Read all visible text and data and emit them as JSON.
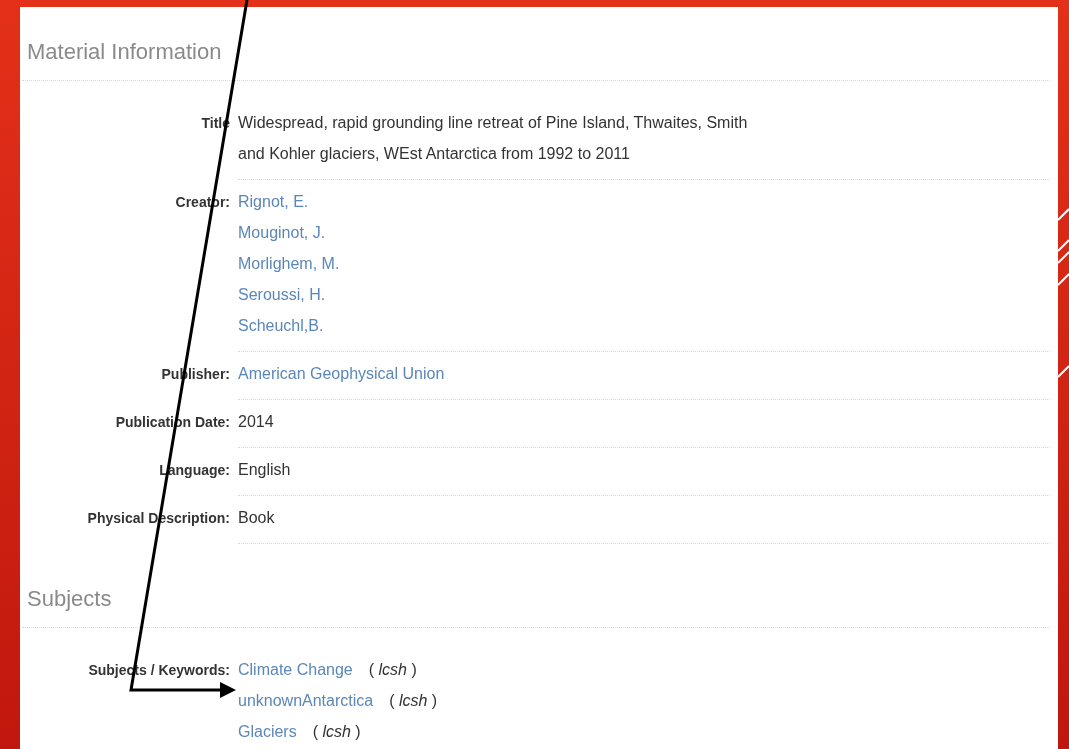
{
  "sections": [
    {
      "heading": "Material Information",
      "fields": [
        {
          "label": "Title",
          "values": [
            {
              "kind": "plain",
              "text": "Widespread, rapid grounding line retreat of Pine Island, Thwaites, Smith and Kohler glaciers, WEst Antarctica from 1992 to 2011"
            }
          ]
        },
        {
          "label": "Creator:",
          "values": [
            {
              "kind": "link",
              "text": "Rignot, E."
            },
            {
              "kind": "link",
              "text": "Mouginot, J."
            },
            {
              "kind": "link",
              "text": "Morlighem, M."
            },
            {
              "kind": "link",
              "text": "Seroussi, H."
            },
            {
              "kind": "link",
              "text": "Scheuchl,B."
            }
          ]
        },
        {
          "label": "Publisher:",
          "values": [
            {
              "kind": "link",
              "text": "American Geophysical Union"
            }
          ]
        },
        {
          "label": "Publication Date:",
          "values": [
            {
              "kind": "plain",
              "text": "2014"
            }
          ]
        },
        {
          "label": "Language:",
          "values": [
            {
              "kind": "plain",
              "text": "English"
            }
          ]
        },
        {
          "label": "Physical Description:",
          "values": [
            {
              "kind": "plain",
              "text": "Book"
            }
          ]
        }
      ]
    },
    {
      "heading": "Subjects",
      "fields": [
        {
          "label": "Subjects / Keywords:",
          "values": [
            {
              "kind": "link",
              "text": "Climate Change",
              "qualifier": "( *lcsh* )"
            },
            {
              "kind": "link",
              "text": "unknownAntarctica",
              "qualifier": "( *lcsh* )"
            },
            {
              "kind": "link",
              "text": "Glaciers",
              "qualifier": "( *lcsh* )"
            }
          ]
        }
      ]
    }
  ]
}
